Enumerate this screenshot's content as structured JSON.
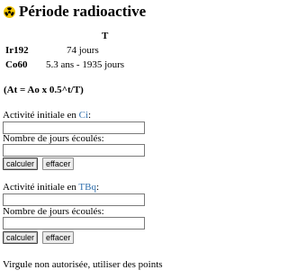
{
  "header": {
    "title": "Période radioactive",
    "icon": "radiation-icon",
    "icon_color": "#f0c400"
  },
  "isotopes": {
    "column_header": "T",
    "rows": [
      {
        "name": "Ir192",
        "period": "74 jours"
      },
      {
        "name": "Co60",
        "period": "5.3 ans - 1935 jours"
      }
    ]
  },
  "formula": "(At = Ao x 0.5^t/T)",
  "form_ci": {
    "activity_label": "Activité initiale en ",
    "activity_unit": "Ci",
    "activity_suffix": ":",
    "activity_value": "",
    "days_label": "Nombre de jours écoulés:",
    "days_value": "",
    "calc_label": "calculer",
    "clear_label": "effacer"
  },
  "form_tbq": {
    "activity_label": "Activité initiale en ",
    "activity_unit": "TBq",
    "activity_suffix": ":",
    "activity_value": "",
    "days_label": "Nombre de jours écoulés:",
    "days_value": "",
    "calc_label": "calculer",
    "clear_label": "effacer"
  },
  "note": "Virgule non autorisée, utiliser des points",
  "colors": {
    "unit_link": "#2f6fad"
  }
}
